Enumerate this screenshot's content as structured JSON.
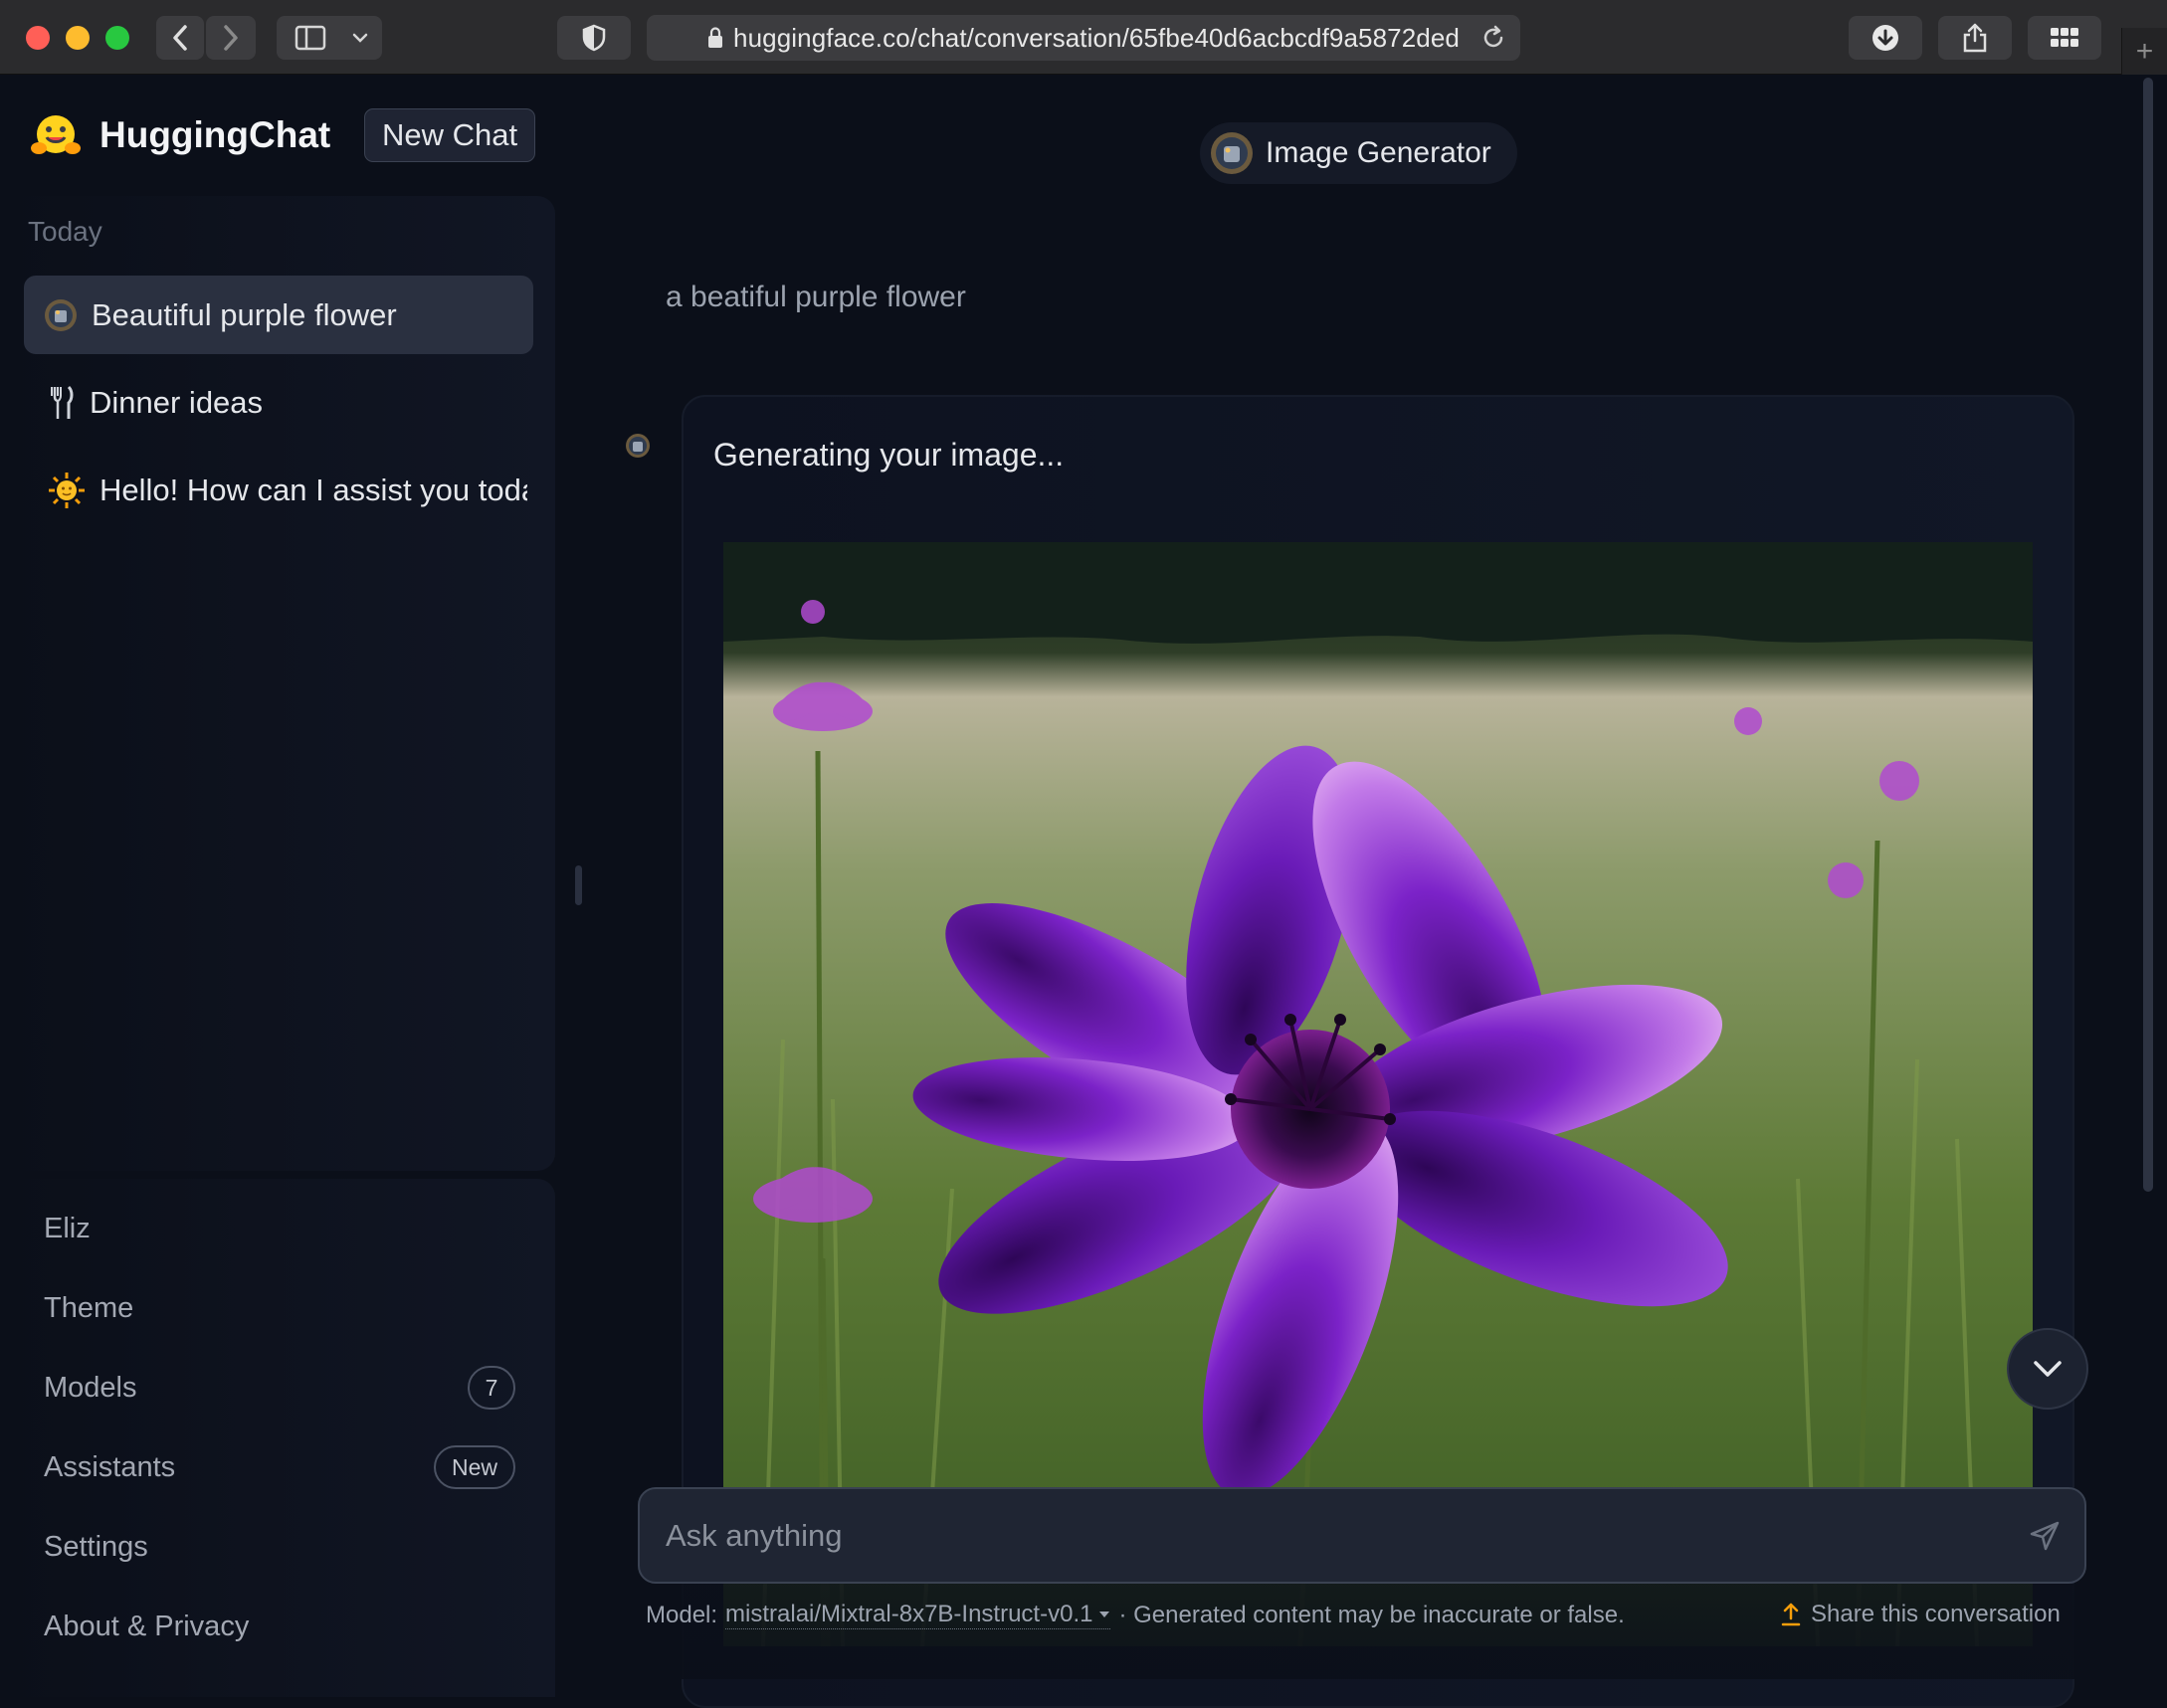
{
  "browser": {
    "url": "huggingface.co/chat/conversation/65fbe40d6acbcdf9a5872ded",
    "new_tab_symbol": "+"
  },
  "sidebar": {
    "brand": "HuggingChat",
    "new_chat_label": "New Chat",
    "section_label": "Today",
    "conversations": [
      {
        "label": "Beautiful purple flower",
        "icon": "assistant-avatar-icon",
        "active": true
      },
      {
        "label": "Dinner ideas",
        "icon": "fork-knife-icon",
        "active": false
      },
      {
        "label": "Hello! How can I assist you toda",
        "icon": "sun-icon",
        "active": false
      }
    ],
    "nav": [
      {
        "label": "Eliz"
      },
      {
        "label": "Theme"
      },
      {
        "label": "Models",
        "badge": "7"
      },
      {
        "label": "Assistants",
        "badge": "New"
      },
      {
        "label": "Settings"
      },
      {
        "label": "About & Privacy"
      }
    ]
  },
  "main": {
    "assistant_name": "Image Generator",
    "user_message": "a beatiful purple flower",
    "bot_message": "Generating your image...",
    "composer_placeholder": "Ask anything",
    "footer_model_prefix": "Model:",
    "footer_model_name": "mistralai/Mixtral-8x7B-Instruct-v0.1",
    "footer_disclaimer": "· Generated content may be inaccurate or false.",
    "share_label": "Share this conversation"
  },
  "colors": {
    "background": "#0b0f19",
    "active_item": "#2a3040",
    "accent_share": "#f59e0b"
  }
}
